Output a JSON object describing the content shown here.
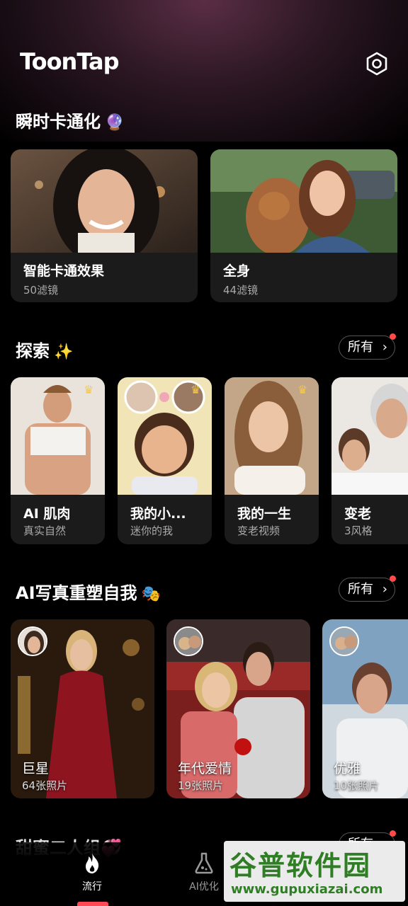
{
  "header": {
    "logo": "ToonTap",
    "settings_icon": "gear-icon"
  },
  "section_instant": {
    "title": "瞬时卡通化",
    "emoji": "🔮",
    "cards": [
      {
        "title": "智能卡通效果",
        "sub": "50滤镜"
      },
      {
        "title": "全身",
        "sub": "44滤镜"
      }
    ]
  },
  "section_explore": {
    "title": "探索",
    "emoji": "✨",
    "all_label": "所有",
    "cards": [
      {
        "title": "AI 肌肉",
        "sub": "真实自然"
      },
      {
        "title": "我的小...",
        "sub": "迷你的我"
      },
      {
        "title": "我的一生",
        "sub": "变老视频"
      },
      {
        "title": "变老",
        "sub": "3风格"
      }
    ]
  },
  "section_portrait": {
    "title": "AI写真重塑自我",
    "emoji": "🎭",
    "all_label": "所有",
    "cards": [
      {
        "title": "巨星",
        "sub": "64张照片"
      },
      {
        "title": "年代爱情",
        "sub": "19张照片"
      },
      {
        "title": "优雅",
        "sub": "10张照片"
      }
    ]
  },
  "section_next": {
    "title": "甜蜜二人组",
    "emoji": "💞",
    "all_label": "所有"
  },
  "tabbar": {
    "tabs": [
      {
        "label": "流行",
        "icon": "flame-icon",
        "active": true
      },
      {
        "label": "AI优化",
        "icon": "flask-icon",
        "active": false
      }
    ]
  },
  "watermark": {
    "line1": "谷普软件园",
    "line2": "www.gupuxiazai.com"
  },
  "colors": {
    "accent": "#ff4a55",
    "crown": "#f6c945",
    "card_bg": "#1b1b1b"
  }
}
